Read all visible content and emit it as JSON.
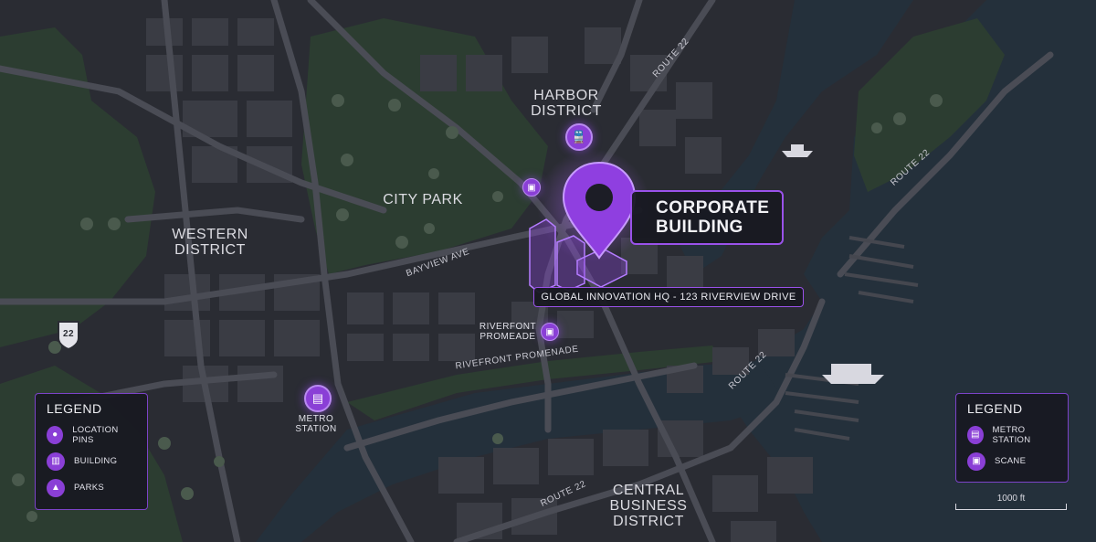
{
  "districts": {
    "harbor": "HARBOR\nDISTRICT",
    "western": "WESTERN\nDISTRICT",
    "city_park": "CITY PARK",
    "central": "CENTRAL\nBUSINESS\nDISTRICT"
  },
  "roads": {
    "route22_north": "ROUTE 22",
    "route22_east": "ROUTE 22",
    "route22_southeast": "ROUTE 22",
    "route22_south": "ROUTE 22",
    "bayview": "BAYVIEW AVE",
    "rivefront": "RIVEFRONT PROMENADE",
    "shield": "22"
  },
  "stations": {
    "metro": "METRO\nSTATION",
    "riverfont": "RIVERFONT\nPROMEADE"
  },
  "callout": {
    "title": "CORPORATE\nBUILDING",
    "address": "GLOBAL INNOVATION HQ - 123 RIVERVIEW DRIVE"
  },
  "legend_left": {
    "title": "LEGEND",
    "items": [
      "LOCATION PINS",
      "BUILDING",
      "PARKS"
    ]
  },
  "legend_right": {
    "title": "LEGEND",
    "items": [
      "METRO STATION",
      "SCANE"
    ]
  },
  "scale": {
    "label": "1000 ft"
  },
  "colors": {
    "accent": "#8a3fd6",
    "accent_light": "#b98af0",
    "water": "#24303b",
    "park": "#2c3d31",
    "land": "#2a2c33",
    "road": "#4a4c55"
  },
  "icons": {
    "main_pin": "location-pin-icon",
    "train": "train-icon",
    "bus": "bus-icon",
    "ship": "ship-icon"
  }
}
